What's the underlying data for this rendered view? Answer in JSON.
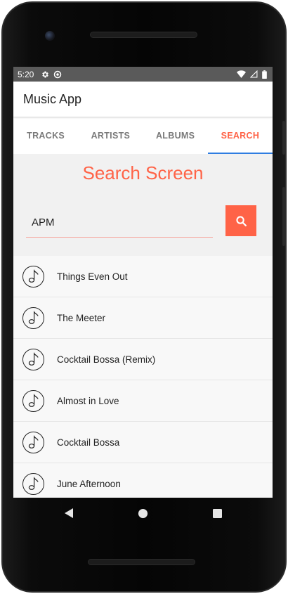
{
  "status_bar": {
    "time": "5:20",
    "icons_left": [
      "settings-icon",
      "sync-icon"
    ],
    "icons_right": [
      "wifi-icon",
      "signal-icon",
      "battery-icon"
    ]
  },
  "app_bar": {
    "title": "Music App"
  },
  "tabs": [
    {
      "label": "TRACKS",
      "active": false
    },
    {
      "label": "ARTISTS",
      "active": false
    },
    {
      "label": "ALBUMS",
      "active": false
    },
    {
      "label": "SEARCH",
      "active": true
    }
  ],
  "search": {
    "title": "Search Screen",
    "query": "APM",
    "button_icon": "search-icon"
  },
  "results": [
    {
      "name": "Things Even Out"
    },
    {
      "name": "The Meeter"
    },
    {
      "name": "Cocktail Bossa (Remix)"
    },
    {
      "name": "Almost in Love"
    },
    {
      "name": "Cocktail Bossa"
    },
    {
      "name": "June Afternoon"
    }
  ],
  "nav_bar": [
    "back-icon",
    "home-icon",
    "recents-icon"
  ],
  "colors": {
    "accent": "#ff6347",
    "tab_indicator": "#2f7de1",
    "status_bar": "#5a5a5a"
  }
}
